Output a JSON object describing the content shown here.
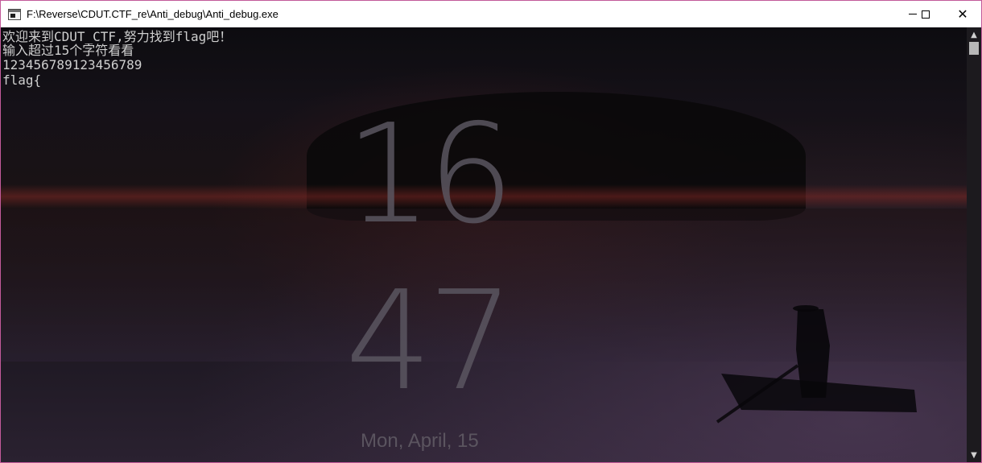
{
  "window": {
    "title": "F:\\Reverse\\CDUT.CTF_re\\Anti_debug\\Anti_debug.exe",
    "app_icon": "console-icon"
  },
  "titlebar_buttons": {
    "minimize_icon": "minimize-icon",
    "maximize_icon": "maximize-icon",
    "close_icon": "close-icon",
    "close_glyph": "✕"
  },
  "console": {
    "lines": [
      "欢迎来到CDUT_CTF,努力找到flag吧！",
      "输入超过15个字符看看",
      "123456789123456789",
      "flag{"
    ]
  },
  "lockscreen": {
    "hour": "16",
    "minute": "47",
    "date": "Mon, April, 15"
  },
  "scrollbar": {
    "up_glyph": "▲",
    "down_glyph": "▼"
  },
  "colors": {
    "border": "#c25a9a",
    "titlebar": "#ffffff",
    "console_text": "#cfcfcf"
  }
}
